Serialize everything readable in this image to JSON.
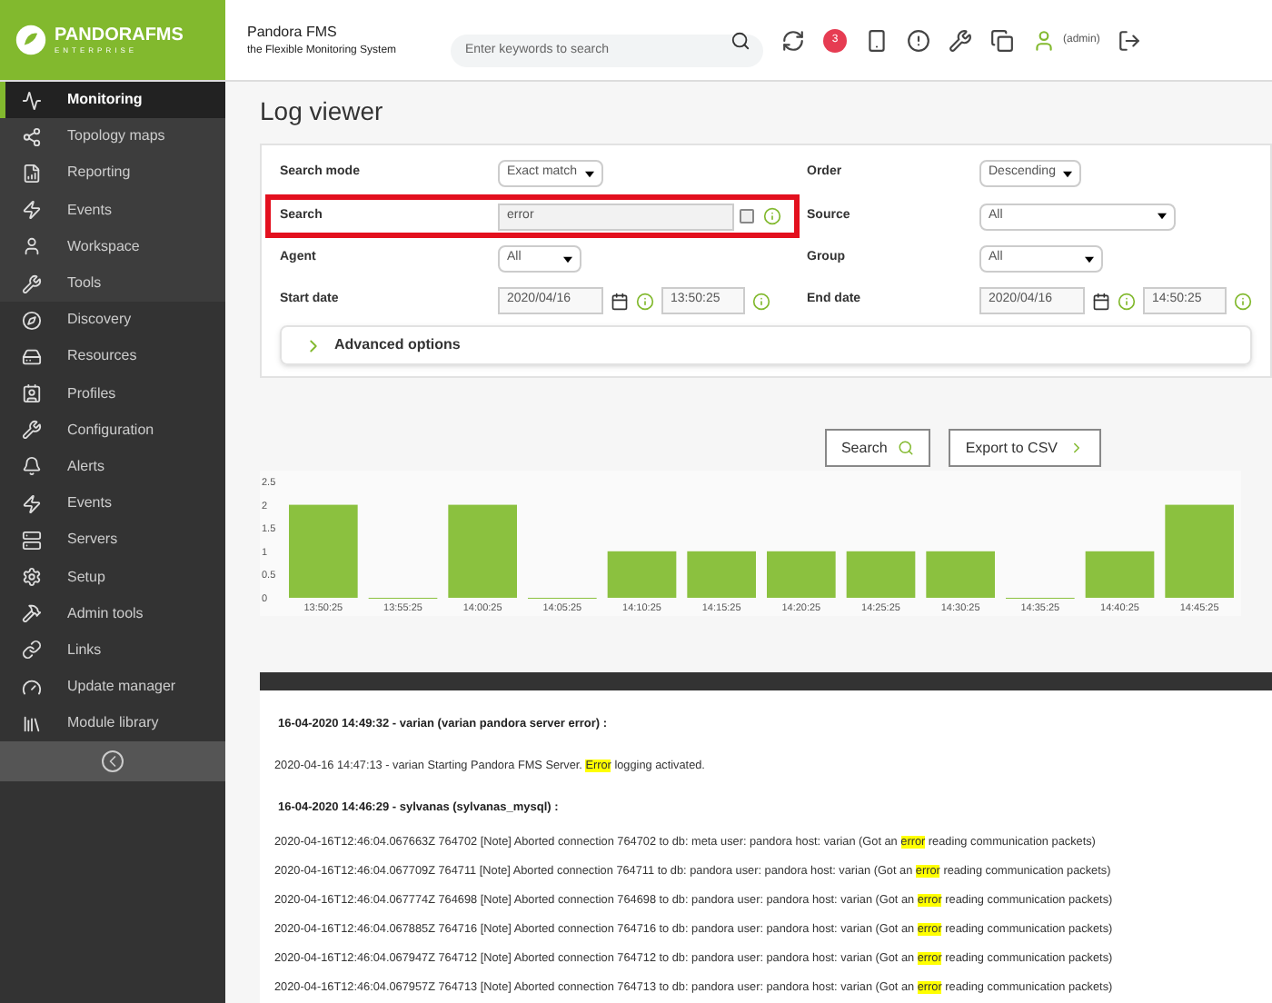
{
  "header": {
    "logo": "PANDORAFMS",
    "logo_sub": "ENTERPRISE",
    "title": "Pandora FMS",
    "subtitle": "the Flexible Monitoring System",
    "search": {
      "placeholder": "Enter keywords to search"
    },
    "notifications": "3",
    "user": "(admin)"
  },
  "sidebar": {
    "items": [
      {
        "label": "Monitoring",
        "selected": true,
        "kind": "operation"
      },
      {
        "label": "Topology maps",
        "selected": false,
        "kind": "operation"
      },
      {
        "label": "Reporting",
        "selected": false,
        "kind": "operation"
      },
      {
        "label": "Events",
        "selected": false,
        "kind": "operation"
      },
      {
        "label": "Workspace",
        "selected": false,
        "kind": "operation"
      },
      {
        "label": "Tools",
        "selected": false,
        "kind": "operation"
      },
      {
        "label": "Discovery",
        "selected": false,
        "kind": "admin"
      },
      {
        "label": "Resources",
        "selected": false,
        "kind": "admin"
      },
      {
        "label": "Profiles",
        "selected": false,
        "kind": "admin"
      },
      {
        "label": "Configuration",
        "selected": false,
        "kind": "admin"
      },
      {
        "label": "Alerts",
        "selected": false,
        "kind": "admin"
      },
      {
        "label": "Events",
        "selected": false,
        "kind": "admin"
      },
      {
        "label": "Servers",
        "selected": false,
        "kind": "admin"
      },
      {
        "label": "Setup",
        "selected": false,
        "kind": "admin"
      },
      {
        "label": "Admin tools",
        "selected": false,
        "kind": "admin"
      },
      {
        "label": "Links",
        "selected": false,
        "kind": "admin"
      },
      {
        "label": "Update manager",
        "selected": false,
        "kind": "admin"
      },
      {
        "label": "Module library",
        "selected": false,
        "kind": "admin"
      }
    ]
  },
  "page_title": "Log viewer",
  "filters": {
    "search_mode": {
      "label": "Search mode",
      "value": "Exact match"
    },
    "order": {
      "label": "Order",
      "value": "Descending"
    },
    "search": {
      "label": "Search",
      "value": "error",
      "checked": false
    },
    "source": {
      "label": "Source",
      "value": "All"
    },
    "agent": {
      "label": "Agent",
      "value": "All"
    },
    "group": {
      "label": "Group",
      "value": "All"
    },
    "start_date": {
      "label": "Start date",
      "date": "2020/04/16",
      "time": "13:50:25"
    },
    "end_date": {
      "label": "End date",
      "date": "2020/04/16",
      "time": "14:50:25"
    },
    "advanced": {
      "label": "Advanced options",
      "expanded": false
    }
  },
  "buttons": [
    "Search",
    "Export to CSV"
  ],
  "chart": {
    "chart_data": {
      "type": "bar",
      "categories": [
        "13:50:25",
        "13:55:25",
        "14:00:25",
        "14:05:25",
        "14:10:25",
        "14:15:25",
        "14:20:25",
        "14:25:25",
        "14:30:25",
        "14:35:25",
        "14:40:25",
        "14:45:25"
      ],
      "values": [
        2,
        0,
        2,
        0,
        1,
        1,
        1,
        1,
        1,
        0,
        1,
        2
      ],
      "ylim": [
        0,
        2.5
      ],
      "yticks": [
        0,
        0.5,
        1,
        1.5,
        2,
        2.5
      ]
    }
  },
  "log": [
    {
      "kind": "header",
      "parts": [
        "16-04-2020 14:49:32 - varian (varian pandora server error) :"
      ]
    },
    {
      "kind": "line",
      "parts": [
        "2020-04-16 14:47:13 - varian Starting Pandora FMS Server. ",
        "Error",
        " logging activated."
      ]
    },
    {
      "kind": "header",
      "parts": [
        "16-04-2020 14:46:29 - sylvanas (sylvanas_mysql) :"
      ]
    },
    {
      "kind": "line",
      "parts": [
        "2020-04-16T12:46:04.067663Z 764702 [Note] Aborted connection 764702 to db: meta user: pandora host: varian (Got an ",
        "error",
        " reading communication packets)"
      ]
    },
    {
      "kind": "line",
      "parts": [
        "2020-04-16T12:46:04.067709Z 764711 [Note] Aborted connection 764711 to db: pandora user: pandora host: varian (Got an ",
        "error",
        " reading communication packets)"
      ]
    },
    {
      "kind": "line",
      "parts": [
        "2020-04-16T12:46:04.067774Z 764698 [Note] Aborted connection 764698 to db: pandora user: pandora host: varian (Got an ",
        "error",
        " reading communication packets)"
      ]
    },
    {
      "kind": "line",
      "parts": [
        "2020-04-16T12:46:04.067885Z 764716 [Note] Aborted connection 764716 to db: pandora user: pandora host: varian (Got an ",
        "error",
        " reading communication packets)"
      ]
    },
    {
      "kind": "line",
      "parts": [
        "2020-04-16T12:46:04.067947Z 764712 [Note] Aborted connection 764712 to db: pandora user: pandora host: varian (Got an ",
        "error",
        " reading communication packets)"
      ]
    },
    {
      "kind": "line",
      "parts": [
        "2020-04-16T12:46:04.067957Z 764713 [Note] Aborted connection 764713 to db: pandora user: pandora host: varian (Got an ",
        "error",
        " reading communication packets)"
      ]
    }
  ]
}
